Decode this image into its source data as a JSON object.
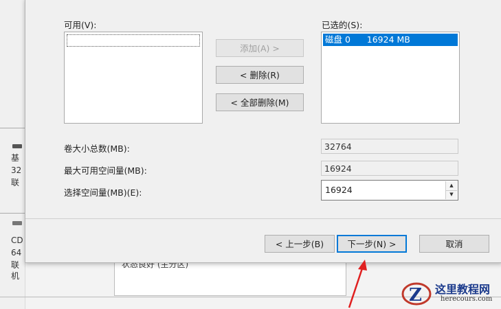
{
  "background": {
    "disk1": {
      "line1": "基",
      "line2": "32",
      "line3": "联"
    },
    "disk2": {
      "line1": "CD",
      "line2": "64",
      "line3": "联机"
    },
    "partition_status": "状态良好 (主分区)"
  },
  "dialog": {
    "available_label": "可用(V):",
    "selected_label": "已选的(S):",
    "selected_items": [
      "磁盘 0      16924 MB"
    ],
    "buttons": {
      "add": "添加(A) >",
      "remove": "< 删除(R)",
      "remove_all": "< 全部删除(M)",
      "back": "< 上一步(B)",
      "next": "下一步(N) >",
      "cancel": "取消"
    },
    "volume_total_label": "卷大小总数(MB):",
    "volume_total_value": "32764",
    "max_available_label": "最大可用空间量(MB):",
    "max_available_value": "16924",
    "select_space_label": "选择空间量(MB)(E):",
    "select_space_value": "16924"
  },
  "watermark": {
    "title": "这里教程网",
    "url": "herecours.com"
  },
  "colors": {
    "selection": "#0078d7",
    "arrow": "#e02020",
    "watermark_blue": "#1b3a8c"
  }
}
